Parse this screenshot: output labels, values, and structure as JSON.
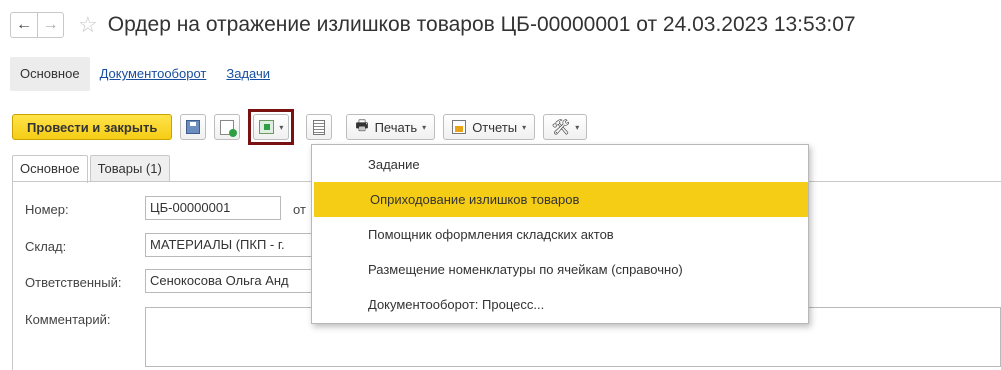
{
  "title": {
    "back_icon": "←",
    "forward_icon": "→",
    "star_icon": "☆",
    "text": "Ордер на отражение излишков товаров ЦБ-00000001 от 24.03.2023 13:53:07"
  },
  "top_tabs": [
    {
      "label": "Основное"
    },
    {
      "label": "Документооборот"
    },
    {
      "label": "Задачи"
    }
  ],
  "toolbar": {
    "primary_label": "Провести и закрыть",
    "caret": "▾",
    "print_icon": "🖶",
    "print_label": "Печать",
    "reports_label": "Отчеты",
    "tools_icon": "🛠"
  },
  "form_tabs": [
    {
      "label": "Основное"
    },
    {
      "label": "Товары (1)"
    }
  ],
  "form": {
    "number_label": "Номер:",
    "number_value": "ЦБ-00000001",
    "from_label": "от",
    "warehouse_label": "Склад:",
    "warehouse_value": "МАТЕРИАЛЫ (ПКП - г.",
    "responsible_label": "Ответственный:",
    "responsible_value": "Сенокосова Ольга Анд",
    "comment_label": "Комментарий:",
    "comment_value": ""
  },
  "menu": {
    "items": [
      {
        "label": "Задание"
      },
      {
        "label": "Оприходование излишков товаров"
      },
      {
        "label": "Помощник оформления складских актов"
      },
      {
        "label": "Размещение номенклатуры по ячейкам (справочно)"
      },
      {
        "label": "Документооборот: Процесс..."
      }
    ]
  },
  "colors": {
    "primary_button": "#f6cd15",
    "highlight_border": "#7a1111",
    "link": "#1a4fa0"
  }
}
